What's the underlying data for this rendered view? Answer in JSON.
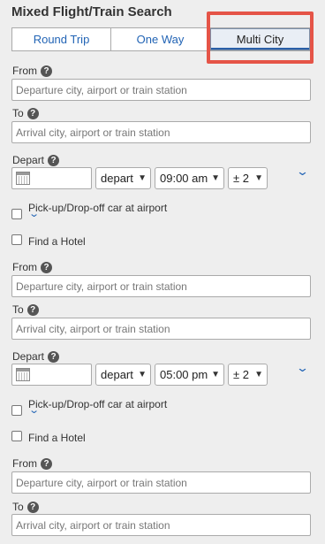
{
  "title": "Mixed Flight/Train Search",
  "tabs": [
    {
      "label": "Round Trip",
      "active": false
    },
    {
      "label": "One Way",
      "active": false
    },
    {
      "label": "Multi City",
      "active": true
    }
  ],
  "legs": [
    {
      "from_label": "From",
      "from_placeholder": "Departure city, airport or train station",
      "to_label": "To",
      "to_placeholder": "Arrival city, airport or train station",
      "depart_label": "Depart",
      "depart_mode": "depart",
      "time": "09:00 am",
      "range": "± 2",
      "car_label": "Pick-up/Drop-off car at airport",
      "hotel_label": "Find a Hotel"
    },
    {
      "from_label": "From",
      "from_placeholder": "Departure city, airport or train station",
      "to_label": "To",
      "to_placeholder": "Arrival city, airport or train station",
      "depart_label": "Depart",
      "depart_mode": "depart",
      "time": "05:00 pm",
      "range": "± 2",
      "car_label": "Pick-up/Drop-off car at airport",
      "hotel_label": "Find a Hotel"
    },
    {
      "from_label": "From",
      "from_placeholder": "Departure city, airport or train station",
      "to_label": "To",
      "to_placeholder": "Arrival city, airport or train station"
    }
  ],
  "help_glyph": "?",
  "colors": {
    "accent": "#2264b5",
    "highlight": "#e55447"
  }
}
